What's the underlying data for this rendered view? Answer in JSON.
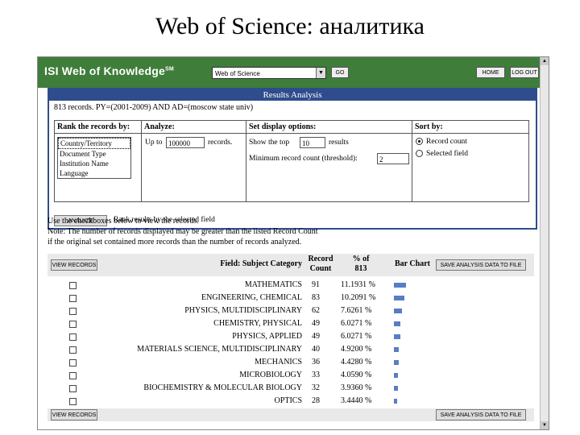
{
  "slide_title": "Web of Science: аналитика",
  "header": {
    "logo": "ISI Web of Knowledge",
    "logo_mark": "SM",
    "database_select": "Web of Science",
    "go_label": "GO",
    "home_label": "HOME",
    "logout_label": "LOG OUT"
  },
  "panel": {
    "title": "Results Analysis",
    "query": "813 records. PY=(2001-2009) AND AD=(moscow state univ)",
    "rank_header": "Rank the records by:",
    "rank_options": [
      "Country/Territory",
      "Document Type",
      "Institution Name",
      "Language"
    ],
    "analyze_header": "Analyze:",
    "up_to_label": "Up to",
    "up_to_value": "100000",
    "records_label": "records.",
    "display_header": "Set display options:",
    "show_top_label": "Show the top",
    "show_top_value": "10",
    "results_label": "results",
    "min_count_label": "Minimum record count (threshold):",
    "min_count_value": "2",
    "sort_header": "Sort by:",
    "sort_options": [
      {
        "label": "Record count",
        "selected": true
      },
      {
        "label": "Selected field",
        "selected": false
      }
    ],
    "analyze_button": "ANALYZE",
    "analyze_note": "Rank results by the selected field"
  },
  "notes": [
    "Use the checkboxes below to view the records.",
    "Note: The number of records displayed may be greater than the listed Record Count",
    "if the original set contained more records than the number of records analyzed."
  ],
  "table": {
    "view_button": "VIEW RECORDS",
    "save_button": "SAVE ANALYSIS DATA TO FILE",
    "field_header": "Field: Subject Category",
    "count_header": "Record Count",
    "pct_header": "% of 813",
    "bar_header": "Bar Chart",
    "rows": [
      {
        "field": "MATHEMATICS",
        "count": "91",
        "pct": "11.1931 %",
        "share": 0.112
      },
      {
        "field": "ENGINEERING, CHEMICAL",
        "count": "83",
        "pct": "10.2091 %",
        "share": 0.102
      },
      {
        "field": "PHYSICS, MULTIDISCIPLINARY",
        "count": "62",
        "pct": "7.6261 %",
        "share": 0.076
      },
      {
        "field": "CHEMISTRY, PHYSICAL",
        "count": "49",
        "pct": "6.0271 %",
        "share": 0.06
      },
      {
        "field": "PHYSICS, APPLIED",
        "count": "49",
        "pct": "6.0271 %",
        "share": 0.06
      },
      {
        "field": "MATERIALS SCIENCE, MULTIDISCIPLINARY",
        "count": "40",
        "pct": "4.9200 %",
        "share": 0.049
      },
      {
        "field": "MECHANICS",
        "count": "36",
        "pct": "4.4280 %",
        "share": 0.044
      },
      {
        "field": "MICROBIOLOGY",
        "count": "33",
        "pct": "4.0590 %",
        "share": 0.041
      },
      {
        "field": "BIOCHEMISTRY & MOLECULAR BIOLOGY",
        "count": "32",
        "pct": "3.9360 %",
        "share": 0.039
      },
      {
        "field": "OPTICS",
        "count": "28",
        "pct": "3.4440 %",
        "share": 0.034
      }
    ]
  },
  "colors": {
    "header_green": "#3f7d3b",
    "panel_blue": "#2f4d8d",
    "bar_blue": "#5a7cc2"
  }
}
